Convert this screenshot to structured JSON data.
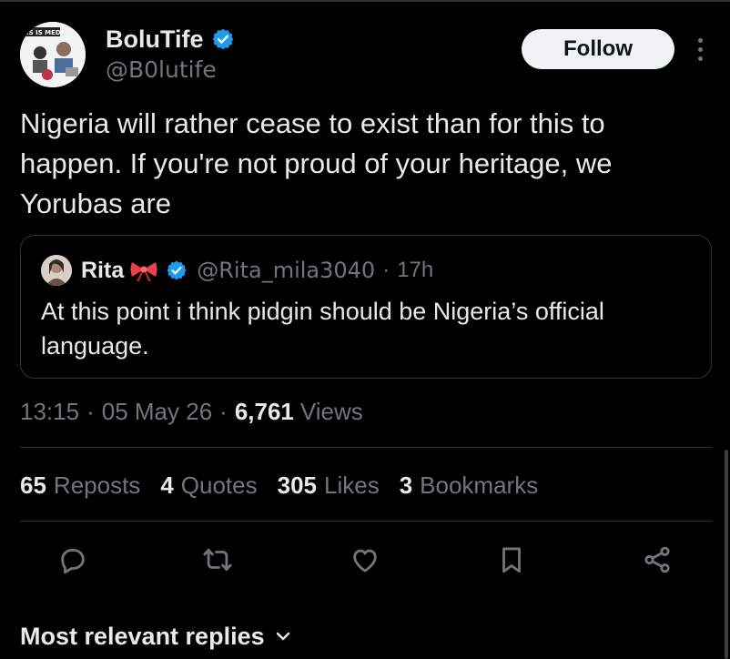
{
  "author": {
    "display_name": "BoluTife",
    "handle": "@B0lutife",
    "avatar_text": "IS IS MED"
  },
  "follow_label": "Follow",
  "tweet": {
    "line1": "Nigeria will rather cease to exist than for this to",
    "line2": "happen. If you're not proud of your heritage, we",
    "line3": "Yorubas are"
  },
  "quote": {
    "name": "Rita",
    "handle": "@Rita_mila3040",
    "dot": "·",
    "time": "17h",
    "line1": "At this point i think pidgin should be Nigeria’s official",
    "line2": "language."
  },
  "meta": {
    "time": "13:15",
    "date": "05 May 26",
    "sep": "·",
    "views_count": "6,761",
    "views_label": "Views"
  },
  "stats": {
    "reposts": {
      "num": "65",
      "label": "Reposts"
    },
    "quotes": {
      "num": "4",
      "label": "Quotes"
    },
    "likes": {
      "num": "305",
      "label": "Likes"
    },
    "bookmarks": {
      "num": "3",
      "label": "Bookmarks"
    }
  },
  "replies_sort_label": "Most relevant replies",
  "colors": {
    "background": "#000000",
    "text": "#e7e9ea",
    "muted": "#71767b",
    "verified": "#1d9bf0",
    "border": "#2f3336"
  },
  "icons": [
    "verified-badge-icon",
    "more-icon",
    "bow-emoji-icon",
    "reply-icon",
    "repost-icon",
    "like-icon",
    "bookmark-icon",
    "share-icon",
    "chevron-down-icon"
  ]
}
